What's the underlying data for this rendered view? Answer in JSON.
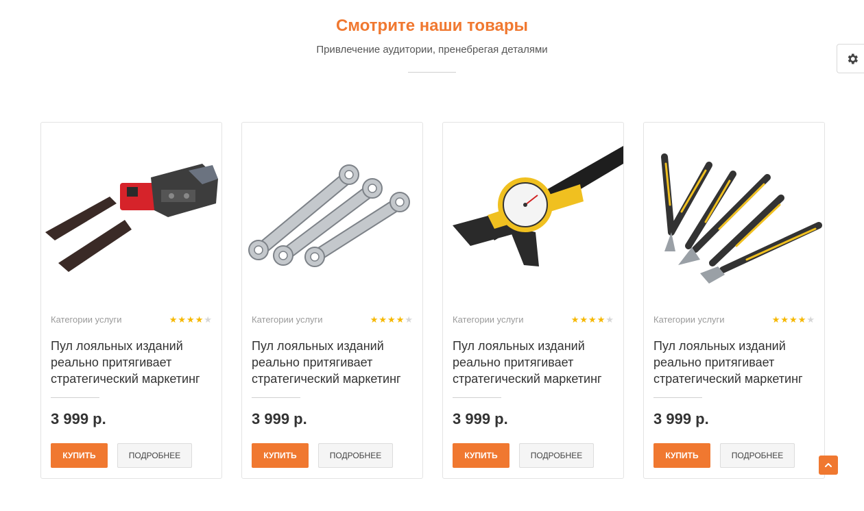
{
  "header": {
    "title": "Смотрите наши товары",
    "subtitle": "Привлечение аудитории, пренебрегая деталями"
  },
  "icons": {
    "settings": "gear-icon",
    "scroll_top": "chevron-up-icon"
  },
  "colors": {
    "accent": "#f07830",
    "star": "#f6b800",
    "star_off": "#d6d6d6"
  },
  "products": [
    {
      "image": "crimping-tool",
      "category": "Категории услуги",
      "rating": 4,
      "rating_max": 5,
      "name": "Пул лояльных изданий реально притягивает стратегический маркетинг",
      "price": "3 999 р.",
      "buy_label": "КУПИТЬ",
      "more_label": "ПОДРОБНЕЕ"
    },
    {
      "image": "wrench-set",
      "category": "Категории услуги",
      "rating": 4,
      "rating_max": 5,
      "name": "Пул лояльных изданий реально притягивает стратегический маркетинг",
      "price": "3 999 р.",
      "buy_label": "КУПИТЬ",
      "more_label": "ПОДРОБНЕЕ"
    },
    {
      "image": "dial-caliper",
      "category": "Категории услуги",
      "rating": 4,
      "rating_max": 5,
      "name": "Пул лояльных изданий реально притягивает стратегический маркетинг",
      "price": "3 999 р.",
      "buy_label": "КУПИТЬ",
      "more_label": "ПОДРОБНЕЕ"
    },
    {
      "image": "pliers-set",
      "category": "Категории услуги",
      "rating": 4,
      "rating_max": 5,
      "name": "Пул лояльных изданий реально притягивает стратегический маркетинг",
      "price": "3 999 р.",
      "buy_label": "КУПИТЬ",
      "more_label": "ПОДРОБНЕЕ"
    }
  ]
}
